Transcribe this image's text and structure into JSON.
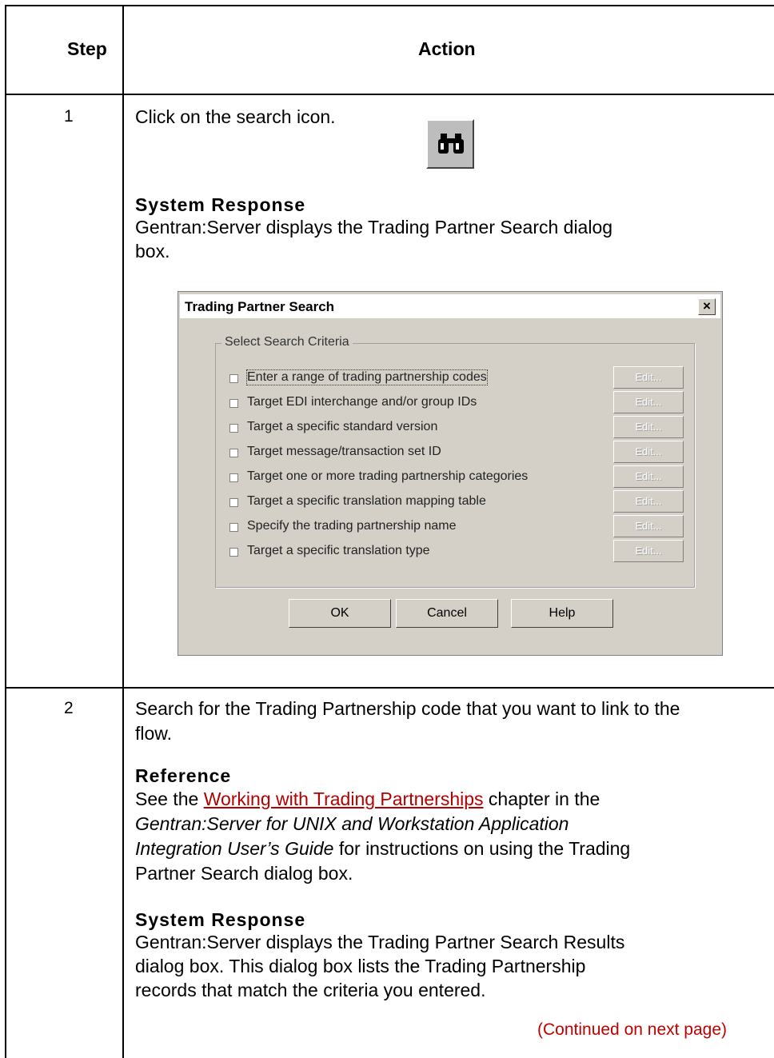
{
  "table": {
    "header_step": "Step",
    "header_action": "Action"
  },
  "step1": {
    "number": "1",
    "instruction": "Click on the search icon.",
    "icon": "binoculars-icon",
    "response_head": "System Response",
    "response_line1": "Gentran:Server displays the Trading Partner Search dialog",
    "response_line2": "box."
  },
  "dialog": {
    "title": "Trading Partner Search",
    "close": "×",
    "group_label": "Select Search Criteria",
    "criteria": [
      "Enter a range of trading partnership codes",
      "Target EDI interchange and/or group IDs",
      "Target a specific standard version",
      "Target message/transaction set ID",
      "Target one or more trading partnership categories",
      "Target a specific translation mapping table",
      "Specify the trading partnership name",
      "Target a specific translation type"
    ],
    "edit_label": "Edit...",
    "ok": "OK",
    "cancel": "Cancel",
    "help": "Help"
  },
  "step2": {
    "number": "2",
    "line1": "Search for the Trading Partnership code that you want to link to the",
    "line2": "flow.",
    "reference_head": "Reference",
    "ref_pre": "See the ",
    "ref_link": "Working with Trading Partnerships",
    "ref_post": " chapter in the",
    "ref_ital1": "Gentran:Server for UNIX and Workstation Application",
    "ref_ital2": "Integration User’s Guide",
    "ref_post2": " for instructions on using the Trading",
    "ref_line4": "Partner Search dialog box.",
    "response_head": "System Response",
    "resp1": "Gentran:Server displays the Trading Partner Search Results",
    "resp2": "dialog box. This dialog box lists the Trading Partnership",
    "resp3": "records that match the criteria you entered.",
    "continued": "(Continued on next page)"
  }
}
